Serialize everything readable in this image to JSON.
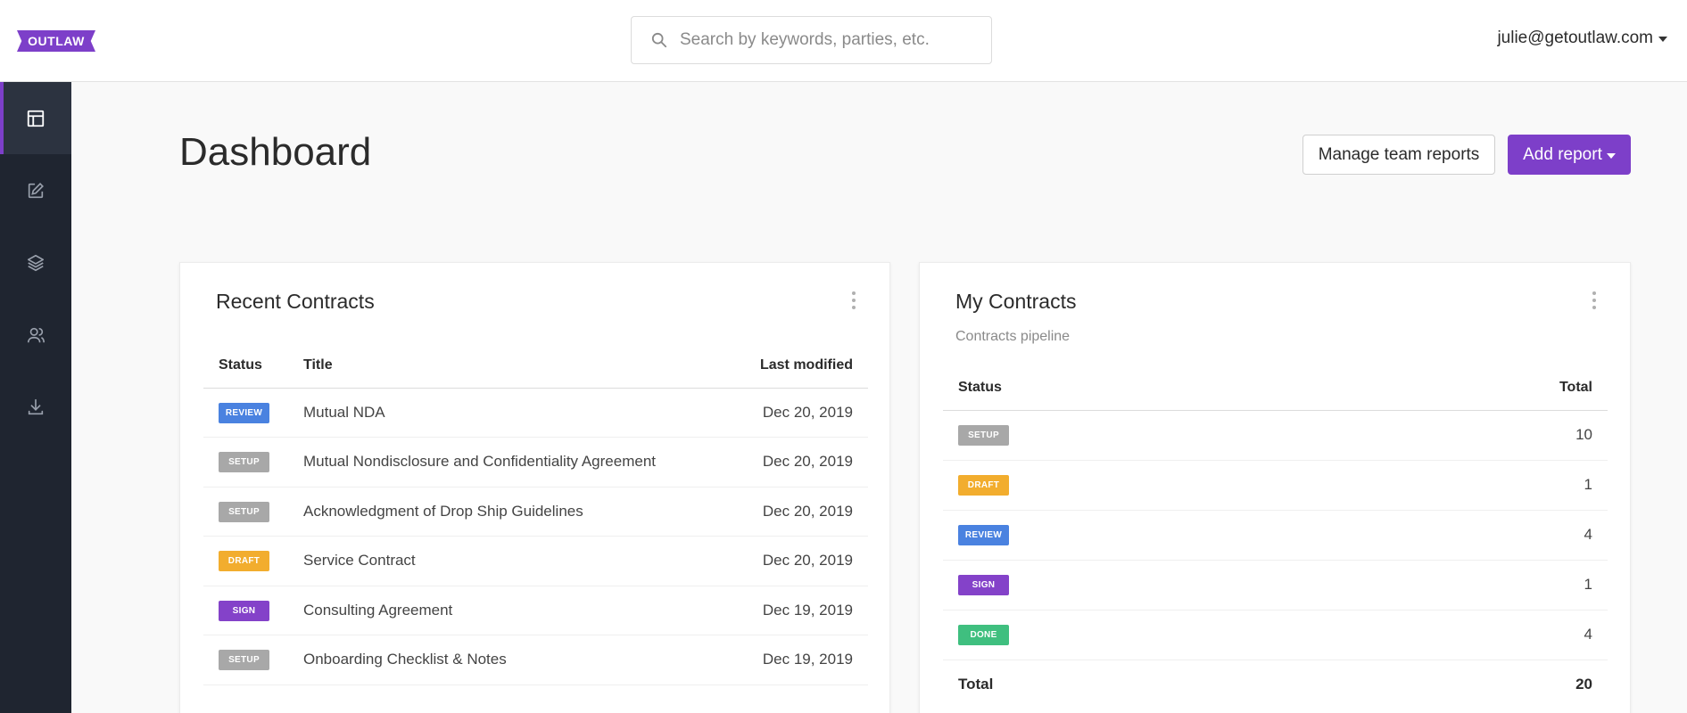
{
  "brand": {
    "logo_text": "OUTLAW",
    "accent": "#7d3fc9"
  },
  "search": {
    "placeholder": "Search by keywords, parties, etc.",
    "value": ""
  },
  "user": {
    "email": "julie@getoutlaw.com"
  },
  "sidebar": {
    "items": [
      {
        "icon": "dashboard-icon",
        "active": true
      },
      {
        "icon": "edit-icon",
        "active": false
      },
      {
        "icon": "layers-icon",
        "active": false
      },
      {
        "icon": "users-icon",
        "active": false
      },
      {
        "icon": "download-icon",
        "active": false
      }
    ]
  },
  "page": {
    "title": "Dashboard",
    "manage_label": "Manage team reports",
    "add_label": "Add report"
  },
  "status_colors": {
    "REVIEW": "#4a82e0",
    "SETUP": "#a8a8a8",
    "DRAFT": "#f2ad2e",
    "SIGN": "#8442c9",
    "DONE": "#3fbf7f"
  },
  "recent": {
    "title": "Recent Contracts",
    "columns": [
      "Status",
      "Title",
      "Last modified"
    ],
    "rows": [
      {
        "status": "REVIEW",
        "title": "Mutual NDA",
        "date": "Dec 20, 2019"
      },
      {
        "status": "SETUP",
        "title": "Mutual Nondisclosure and Confidentiality Agreement",
        "date": "Dec 20, 2019"
      },
      {
        "status": "SETUP",
        "title": "Acknowledgment of Drop Ship Guidelines",
        "date": "Dec 20, 2019"
      },
      {
        "status": "DRAFT",
        "title": "Service Contract",
        "date": "Dec 20, 2019"
      },
      {
        "status": "SIGN",
        "title": "Consulting Agreement",
        "date": "Dec 19, 2019"
      },
      {
        "status": "SETUP",
        "title": "Onboarding Checklist & Notes",
        "date": "Dec 19, 2019"
      }
    ]
  },
  "mine": {
    "title": "My Contracts",
    "subtitle": "Contracts pipeline",
    "columns": [
      "Status",
      "Total"
    ],
    "rows": [
      {
        "status": "SETUP",
        "total": "10"
      },
      {
        "status": "DRAFT",
        "total": "1"
      },
      {
        "status": "REVIEW",
        "total": "4"
      },
      {
        "status": "SIGN",
        "total": "1"
      },
      {
        "status": "DONE",
        "total": "4"
      }
    ],
    "total_label": "Total",
    "total_value": "20"
  }
}
